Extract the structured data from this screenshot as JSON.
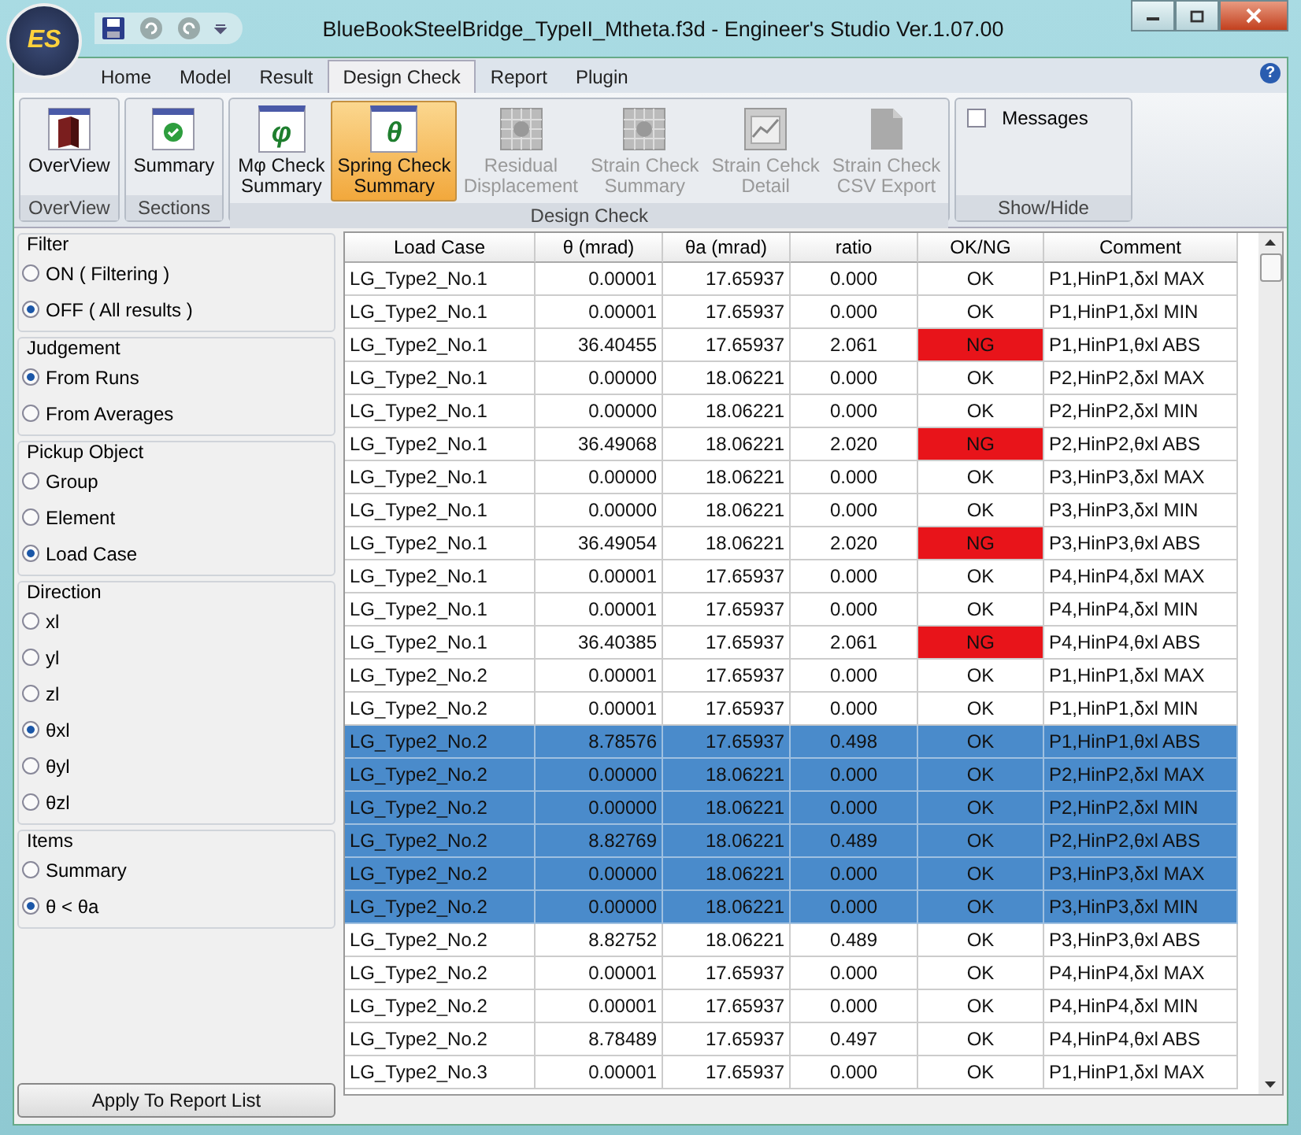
{
  "window": {
    "title": "BlueBookSteelBridge_TypeII_Mtheta.f3d - Engineer's Studio Ver.1.07.00",
    "logo": "ES"
  },
  "tabs": [
    {
      "label": "Home",
      "selected": false
    },
    {
      "label": "Model",
      "selected": false
    },
    {
      "label": "Result",
      "selected": false
    },
    {
      "label": "Design Check",
      "selected": true
    },
    {
      "label": "Report",
      "selected": false
    },
    {
      "label": "Plugin",
      "selected": false
    }
  ],
  "help": "?",
  "ribbon": [
    {
      "label": "OverView",
      "buttons": [
        {
          "kind": "book",
          "lines": [
            "OverView"
          ],
          "selected": false,
          "disabled": false
        }
      ]
    },
    {
      "label": "Sections",
      "buttons": [
        {
          "kind": "check",
          "lines": [
            "Summary"
          ],
          "selected": false,
          "disabled": false
        }
      ]
    },
    {
      "label": "Design Check",
      "buttons": [
        {
          "kind": "glyph",
          "glyph": "φ",
          "lines": [
            "Mφ Check",
            "Summary"
          ],
          "selected": false,
          "disabled": false
        },
        {
          "kind": "glyph",
          "glyph": "θ",
          "lines": [
            "Spring Check",
            "Summary"
          ],
          "selected": true,
          "disabled": false
        },
        {
          "kind": "grid",
          "lines": [
            "Residual",
            "Displacement"
          ],
          "selected": false,
          "disabled": true
        },
        {
          "kind": "grid",
          "lines": [
            "Strain Check",
            "Summary"
          ],
          "selected": false,
          "disabled": true
        },
        {
          "kind": "chart",
          "lines": [
            "Strain Cehck",
            "Detail"
          ],
          "selected": false,
          "disabled": true
        },
        {
          "kind": "doc",
          "lines": [
            "Strain Check",
            "CSV Export"
          ],
          "selected": false,
          "disabled": true
        }
      ]
    },
    {
      "label": "Show/Hide",
      "checkbox": {
        "label": "Messages",
        "checked": false
      }
    }
  ],
  "filters": [
    {
      "title": "Filter",
      "options": [
        {
          "label": "ON   ( Filtering )",
          "selected": false
        },
        {
          "label": "OFF ( All results )",
          "selected": true
        }
      ]
    },
    {
      "title": "Judgement",
      "options": [
        {
          "label": "From Runs",
          "selected": true
        },
        {
          "label": "From Averages",
          "selected": false
        }
      ]
    },
    {
      "title": "Pickup Object",
      "options": [
        {
          "label": "Group",
          "selected": false
        },
        {
          "label": "Element",
          "selected": false
        },
        {
          "label": "Load Case",
          "selected": true
        }
      ]
    },
    {
      "title": "Direction",
      "options": [
        {
          "label": "xl",
          "selected": false
        },
        {
          "label": "yl",
          "selected": false
        },
        {
          "label": "zl",
          "selected": false
        },
        {
          "label": "θxl",
          "selected": true
        },
        {
          "label": "θyl",
          "selected": false
        },
        {
          "label": "θzl",
          "selected": false
        }
      ]
    },
    {
      "title": "Items",
      "options": [
        {
          "label": "Summary",
          "selected": false
        },
        {
          "label": "θ < θa",
          "selected": true
        }
      ]
    }
  ],
  "apply_button": "Apply To Report List",
  "table": {
    "columns": [
      "Load Case",
      "θ (mrad)",
      "θa (mrad)",
      "ratio",
      "OK/NG",
      "Comment"
    ],
    "rows": [
      {
        "load_case": "LG_Type2_No.1",
        "theta": "0.00001",
        "theta_a": "17.65937",
        "ratio": "0.000",
        "judgement": "OK",
        "failed": false,
        "comment": "P1,HinP1,δxl MAX",
        "selected": false
      },
      {
        "load_case": "LG_Type2_No.1",
        "theta": "0.00001",
        "theta_a": "17.65937",
        "ratio": "0.000",
        "judgement": "OK",
        "failed": false,
        "comment": "P1,HinP1,δxl MIN",
        "selected": false
      },
      {
        "load_case": "LG_Type2_No.1",
        "theta": "36.40455",
        "theta_a": "17.65937",
        "ratio": "2.061",
        "judgement": "NG",
        "failed": true,
        "comment": "P1,HinP1,θxl ABS",
        "selected": false
      },
      {
        "load_case": "LG_Type2_No.1",
        "theta": "0.00000",
        "theta_a": "18.06221",
        "ratio": "0.000",
        "judgement": "OK",
        "failed": false,
        "comment": "P2,HinP2,δxl MAX",
        "selected": false
      },
      {
        "load_case": "LG_Type2_No.1",
        "theta": "0.00000",
        "theta_a": "18.06221",
        "ratio": "0.000",
        "judgement": "OK",
        "failed": false,
        "comment": "P2,HinP2,δxl MIN",
        "selected": false
      },
      {
        "load_case": "LG_Type2_No.1",
        "theta": "36.49068",
        "theta_a": "18.06221",
        "ratio": "2.020",
        "judgement": "NG",
        "failed": true,
        "comment": "P2,HinP2,θxl ABS",
        "selected": false
      },
      {
        "load_case": "LG_Type2_No.1",
        "theta": "0.00000",
        "theta_a": "18.06221",
        "ratio": "0.000",
        "judgement": "OK",
        "failed": false,
        "comment": "P3,HinP3,δxl MAX",
        "selected": false
      },
      {
        "load_case": "LG_Type2_No.1",
        "theta": "0.00000",
        "theta_a": "18.06221",
        "ratio": "0.000",
        "judgement": "OK",
        "failed": false,
        "comment": "P3,HinP3,δxl MIN",
        "selected": false
      },
      {
        "load_case": "LG_Type2_No.1",
        "theta": "36.49054",
        "theta_a": "18.06221",
        "ratio": "2.020",
        "judgement": "NG",
        "failed": true,
        "comment": "P3,HinP3,θxl ABS",
        "selected": false
      },
      {
        "load_case": "LG_Type2_No.1",
        "theta": "0.00001",
        "theta_a": "17.65937",
        "ratio": "0.000",
        "judgement": "OK",
        "failed": false,
        "comment": "P4,HinP4,δxl MAX",
        "selected": false
      },
      {
        "load_case": "LG_Type2_No.1",
        "theta": "0.00001",
        "theta_a": "17.65937",
        "ratio": "0.000",
        "judgement": "OK",
        "failed": false,
        "comment": "P4,HinP4,δxl MIN",
        "selected": false
      },
      {
        "load_case": "LG_Type2_No.1",
        "theta": "36.40385",
        "theta_a": "17.65937",
        "ratio": "2.061",
        "judgement": "NG",
        "failed": true,
        "comment": "P4,HinP4,θxl ABS",
        "selected": false
      },
      {
        "load_case": "LG_Type2_No.2",
        "theta": "0.00001",
        "theta_a": "17.65937",
        "ratio": "0.000",
        "judgement": "OK",
        "failed": false,
        "comment": "P1,HinP1,δxl MAX",
        "selected": false
      },
      {
        "load_case": "LG_Type2_No.2",
        "theta": "0.00001",
        "theta_a": "17.65937",
        "ratio": "0.000",
        "judgement": "OK",
        "failed": false,
        "comment": "P1,HinP1,δxl MIN",
        "selected": false
      },
      {
        "load_case": "LG_Type2_No.2",
        "theta": "8.78576",
        "theta_a": "17.65937",
        "ratio": "0.498",
        "judgement": "OK",
        "failed": false,
        "comment": "P1,HinP1,θxl ABS",
        "selected": true
      },
      {
        "load_case": "LG_Type2_No.2",
        "theta": "0.00000",
        "theta_a": "18.06221",
        "ratio": "0.000",
        "judgement": "OK",
        "failed": false,
        "comment": "P2,HinP2,δxl MAX",
        "selected": true
      },
      {
        "load_case": "LG_Type2_No.2",
        "theta": "0.00000",
        "theta_a": "18.06221",
        "ratio": "0.000",
        "judgement": "OK",
        "failed": false,
        "comment": "P2,HinP2,δxl MIN",
        "selected": true
      },
      {
        "load_case": "LG_Type2_No.2",
        "theta": "8.82769",
        "theta_a": "18.06221",
        "ratio": "0.489",
        "judgement": "OK",
        "failed": false,
        "comment": "P2,HinP2,θxl ABS",
        "selected": true
      },
      {
        "load_case": "LG_Type2_No.2",
        "theta": "0.00000",
        "theta_a": "18.06221",
        "ratio": "0.000",
        "judgement": "OK",
        "failed": false,
        "comment": "P3,HinP3,δxl MAX",
        "selected": true
      },
      {
        "load_case": "LG_Type2_No.2",
        "theta": "0.00000",
        "theta_a": "18.06221",
        "ratio": "0.000",
        "judgement": "OK",
        "failed": false,
        "comment": "P3,HinP3,δxl MIN",
        "selected": true
      },
      {
        "load_case": "LG_Type2_No.2",
        "theta": "8.82752",
        "theta_a": "18.06221",
        "ratio": "0.489",
        "judgement": "OK",
        "failed": false,
        "comment": "P3,HinP3,θxl ABS",
        "selected": false
      },
      {
        "load_case": "LG_Type2_No.2",
        "theta": "0.00001",
        "theta_a": "17.65937",
        "ratio": "0.000",
        "judgement": "OK",
        "failed": false,
        "comment": "P4,HinP4,δxl MAX",
        "selected": false
      },
      {
        "load_case": "LG_Type2_No.2",
        "theta": "0.00001",
        "theta_a": "17.65937",
        "ratio": "0.000",
        "judgement": "OK",
        "failed": false,
        "comment": "P4,HinP4,δxl MIN",
        "selected": false
      },
      {
        "load_case": "LG_Type2_No.2",
        "theta": "8.78489",
        "theta_a": "17.65937",
        "ratio": "0.497",
        "judgement": "OK",
        "failed": false,
        "comment": "P4,HinP4,θxl ABS",
        "selected": false
      },
      {
        "load_case": "LG_Type2_No.3",
        "theta": "0.00001",
        "theta_a": "17.65937",
        "ratio": "0.000",
        "judgement": "OK",
        "failed": false,
        "comment": "P1,HinP1,δxl MAX",
        "selected": false
      }
    ]
  }
}
